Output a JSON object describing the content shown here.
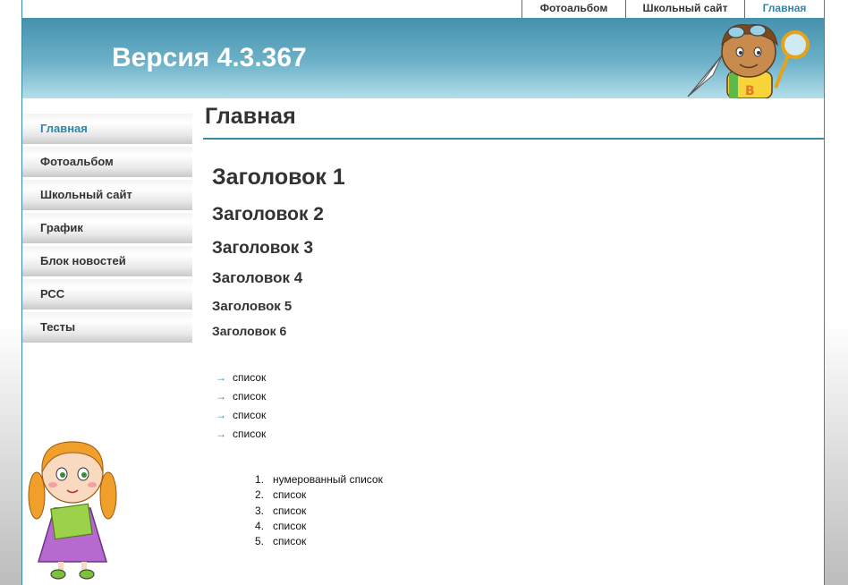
{
  "topnav": {
    "items": [
      {
        "label": "Фотоальбом",
        "active": false
      },
      {
        "label": "Школьный сайт",
        "active": false
      },
      {
        "label": "Главная",
        "active": true
      }
    ]
  },
  "header": {
    "title": "Версия 4.3.367",
    "mascot_letter": "B"
  },
  "sidebar": {
    "items": [
      {
        "label": "Главная",
        "active": true
      },
      {
        "label": "Фотоальбом"
      },
      {
        "label": "Школьный сайт"
      },
      {
        "label": "График"
      },
      {
        "label": "Блок новостей"
      },
      {
        "label": "РСС"
      },
      {
        "label": "Тесты"
      }
    ]
  },
  "main": {
    "title": "Главная",
    "headings": [
      "Заголовок 1",
      "Заголовок 2",
      "Заголовок 3",
      "Заголовок 4",
      "Заголовок 5",
      "Заголовок 6"
    ],
    "bullet_symbol": "→",
    "bullet_list": [
      "список",
      "список",
      "список",
      "список"
    ],
    "numbered_list": [
      {
        "num": "1.",
        "text": "нумерованный список"
      },
      {
        "num": "2.",
        "text": "список"
      },
      {
        "num": "3.",
        "text": "список"
      },
      {
        "num": "4.",
        "text": "список"
      },
      {
        "num": "5.",
        "text": "список"
      }
    ]
  },
  "colors": {
    "accent": "#2e87a8",
    "header_top": "#4591ad",
    "header_bottom": "#b4dfea",
    "text": "#333333"
  }
}
